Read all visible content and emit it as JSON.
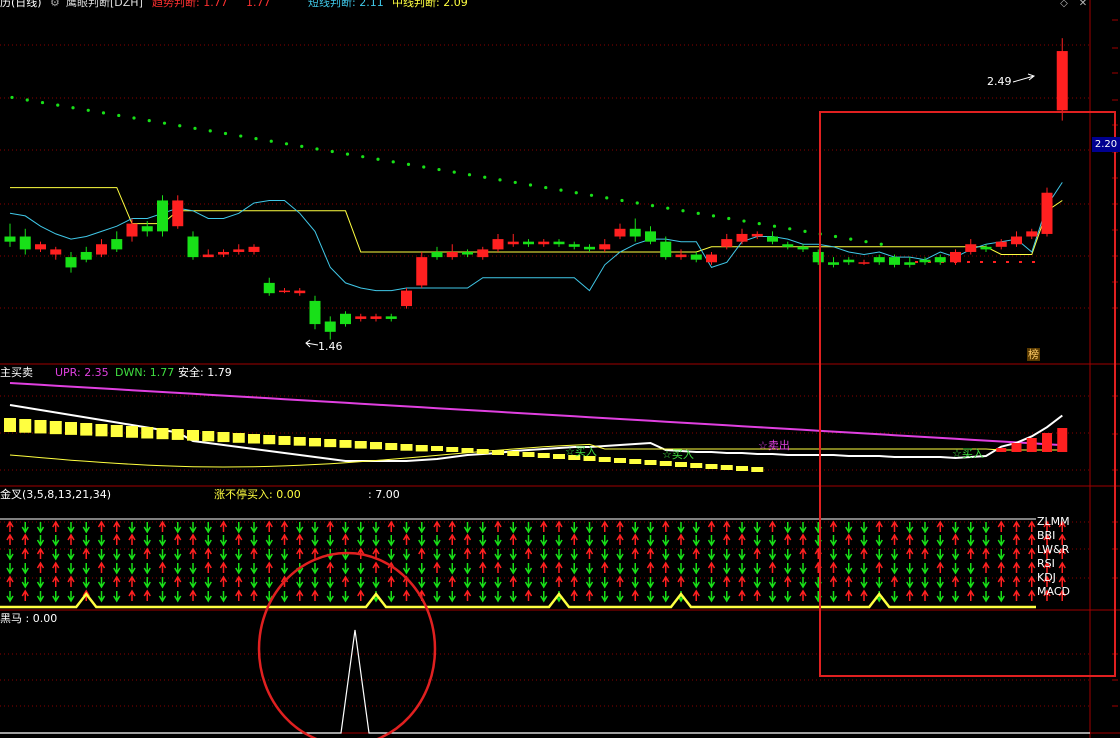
{
  "header": {
    "period_label": "历(日线)",
    "indicator_name": "鹰眼判断[DZH]",
    "trend_label": "趋势判断: 1.77",
    "trend_value2": "1.77",
    "short_label": "短线判断: 2.11",
    "mid_label": "中线判断: 2.09"
  },
  "main_chart": {
    "high_marker": "2.49",
    "low_marker": "1.46",
    "price_axis_value": "2.20",
    "rank_badge": "榜"
  },
  "panel2": {
    "title": "主买卖",
    "upr": "UPR: 2.35",
    "dwn": "DWN: 1.77",
    "safe": "安全: 1.79",
    "signals": [
      "☆买入",
      "☆买入",
      "☆卖出",
      "☆买入"
    ]
  },
  "panel3": {
    "title": "金叉(3,5,8,13,21,34)",
    "limit_label": "涨不停买入: 0.00",
    "extra_value": ": 7.00",
    "row_labels": [
      "ZLMM",
      "BBI",
      "LW&R",
      "RSI",
      "KDJ",
      "MACD"
    ]
  },
  "panel4": {
    "title": "黑马 : 0.00"
  },
  "colors": {
    "up": "#ff2020",
    "down": "#18e018",
    "bg": "#000000",
    "yellow": "#ffff40",
    "cyan": "#40c8e8",
    "magenta": "#e040e0",
    "grid": "#8a0000",
    "highlight_box": "#e02020"
  },
  "chart_data": [
    {
      "type": "candlestick",
      "candles": [
        [
          1.86,
          1.84,
          1.91,
          1.82
        ],
        [
          1.86,
          1.81,
          1.89,
          1.79
        ],
        [
          1.81,
          1.83,
          1.84,
          1.8
        ],
        [
          1.79,
          1.81,
          1.82,
          1.77
        ],
        [
          1.78,
          1.74,
          1.8,
          1.72
        ],
        [
          1.8,
          1.77,
          1.82,
          1.76
        ],
        [
          1.79,
          1.83,
          1.85,
          1.78
        ],
        [
          1.85,
          1.81,
          1.88,
          1.8
        ],
        [
          1.86,
          1.91,
          1.93,
          1.84
        ],
        [
          1.9,
          1.88,
          1.92,
          1.86
        ],
        [
          2.0,
          1.88,
          2.02,
          1.86
        ],
        [
          1.9,
          2.0,
          2.02,
          1.89
        ],
        [
          1.86,
          1.78,
          1.88,
          1.77
        ],
        [
          1.78,
          1.79,
          1.81,
          1.78
        ],
        [
          1.79,
          1.8,
          1.81,
          1.78
        ],
        [
          1.8,
          1.81,
          1.83,
          1.79
        ],
        [
          1.8,
          1.82,
          1.83,
          1.79
        ],
        [
          1.68,
          1.64,
          1.7,
          1.63
        ],
        [
          1.65,
          1.65,
          1.66,
          1.64
        ],
        [
          1.64,
          1.65,
          1.66,
          1.63
        ],
        [
          1.61,
          1.52,
          1.63,
          1.5
        ],
        [
          1.53,
          1.49,
          1.55,
          1.46
        ],
        [
          1.56,
          1.52,
          1.57,
          1.51
        ],
        [
          1.54,
          1.55,
          1.56,
          1.53
        ],
        [
          1.54,
          1.55,
          1.56,
          1.53
        ],
        [
          1.55,
          1.54,
          1.56,
          1.53
        ],
        [
          1.59,
          1.65,
          1.66,
          1.58
        ],
        [
          1.67,
          1.78,
          1.8,
          1.66
        ],
        [
          1.8,
          1.78,
          1.82,
          1.77
        ],
        [
          1.78,
          1.8,
          1.83,
          1.77
        ],
        [
          1.8,
          1.79,
          1.81,
          1.78
        ],
        [
          1.78,
          1.81,
          1.82,
          1.77
        ],
        [
          1.81,
          1.85,
          1.87,
          1.8
        ],
        [
          1.83,
          1.84,
          1.87,
          1.82
        ],
        [
          1.84,
          1.83,
          1.85,
          1.82
        ],
        [
          1.83,
          1.84,
          1.85,
          1.82
        ],
        [
          1.84,
          1.83,
          1.85,
          1.82
        ],
        [
          1.83,
          1.82,
          1.84,
          1.81
        ],
        [
          1.82,
          1.81,
          1.83,
          1.8
        ],
        [
          1.81,
          1.83,
          1.85,
          1.8
        ],
        [
          1.86,
          1.89,
          1.91,
          1.85
        ],
        [
          1.89,
          1.86,
          1.93,
          1.84
        ],
        [
          1.88,
          1.84,
          1.9,
          1.83
        ],
        [
          1.84,
          1.78,
          1.86,
          1.77
        ],
        [
          1.78,
          1.79,
          1.81,
          1.77
        ],
        [
          1.79,
          1.77,
          1.8,
          1.76
        ],
        [
          1.76,
          1.79,
          1.8,
          1.75
        ],
        [
          1.82,
          1.85,
          1.87,
          1.81
        ],
        [
          1.84,
          1.87,
          1.89,
          1.83
        ],
        [
          1.86,
          1.87,
          1.88,
          1.85
        ],
        [
          1.86,
          1.84,
          1.88,
          1.83
        ],
        [
          1.83,
          1.82,
          1.84,
          1.81
        ],
        [
          1.82,
          1.81,
          1.83,
          1.8
        ],
        [
          1.8,
          1.76,
          1.81,
          1.75
        ],
        [
          1.76,
          1.75,
          1.78,
          1.74
        ],
        [
          1.77,
          1.76,
          1.78,
          1.75
        ],
        [
          1.76,
          1.76,
          1.77,
          1.75
        ],
        [
          1.78,
          1.76,
          1.79,
          1.75
        ],
        [
          1.78,
          1.75,
          1.79,
          1.74
        ],
        [
          1.76,
          1.75,
          1.78,
          1.74
        ],
        [
          1.77,
          1.76,
          1.78,
          1.75
        ],
        [
          1.78,
          1.76,
          1.79,
          1.75
        ],
        [
          1.76,
          1.8,
          1.81,
          1.75
        ],
        [
          1.8,
          1.83,
          1.85,
          1.79
        ],
        [
          1.82,
          1.81,
          1.83,
          1.8
        ],
        [
          1.82,
          1.84,
          1.85,
          1.81
        ],
        [
          1.83,
          1.86,
          1.88,
          1.82
        ],
        [
          1.86,
          1.88,
          1.89,
          1.85
        ],
        [
          1.87,
          2.03,
          2.05,
          1.86
        ],
        [
          2.35,
          2.58,
          2.63,
          2.31
        ]
      ],
      "series": [
        {
          "values": [
            2.05,
            2.05,
            2.05,
            2.05,
            2.05,
            2.05,
            2.05,
            2.05,
            1.91,
            1.91,
            1.91,
            1.96,
            1.96,
            1.96,
            1.96,
            1.96,
            1.96,
            1.96,
            1.96,
            1.96,
            1.96,
            1.96,
            1.96,
            1.8,
            1.8,
            1.8,
            1.8,
            1.8,
            1.8,
            1.8,
            1.8,
            1.8,
            1.8,
            1.8,
            1.8,
            1.8,
            1.8,
            1.8,
            1.8,
            1.8,
            1.8,
            1.8,
            1.8,
            1.8,
            1.8,
            1.8,
            1.82,
            1.82,
            1.82,
            1.82,
            1.82,
            1.82,
            1.82,
            1.82,
            1.82,
            1.82,
            1.82,
            1.82,
            1.82,
            1.82,
            1.82,
            1.82,
            1.82,
            1.82,
            1.82,
            1.79,
            1.79,
            1.79,
            1.96,
            2.0
          ]
        },
        {
          "values": [
            1.95,
            1.94,
            1.9,
            1.87,
            1.85,
            1.86,
            1.88,
            1.9,
            1.93,
            1.93,
            1.95,
            1.97,
            1.96,
            1.93,
            1.93,
            1.95,
            1.99,
            2.0,
            2.0,
            1.95,
            1.88,
            1.74,
            1.68,
            1.66,
            1.65,
            1.65,
            1.66,
            1.66,
            1.66,
            1.66,
            1.66,
            1.7,
            1.7,
            1.7,
            1.7,
            1.7,
            1.7,
            1.7,
            1.65,
            1.75,
            1.8,
            1.83,
            1.85,
            1.85,
            1.84,
            1.84,
            1.74,
            1.76,
            1.84,
            1.86,
            1.86,
            1.85,
            1.83,
            1.83,
            1.82,
            1.8,
            1.79,
            1.8,
            1.78,
            1.78,
            1.77,
            1.8,
            1.78,
            1.81,
            1.83,
            1.84,
            1.85,
            1.8,
            1.98,
            2.07
          ]
        },
        {
          "values": [
            2.4,
            2.39,
            2.38,
            2.37,
            2.36,
            2.35,
            2.34,
            2.33,
            2.32,
            2.31,
            2.3,
            2.29,
            2.28,
            2.27,
            2.26,
            2.25,
            2.24,
            2.23,
            2.22,
            2.21,
            2.2,
            2.19,
            2.18,
            2.17,
            2.16,
            2.15,
            2.14,
            2.13,
            2.12,
            2.11,
            2.1,
            2.09,
            2.08,
            2.07,
            2.06,
            2.05,
            2.04,
            2.03,
            2.02,
            2.01,
            2.0,
            1.99,
            1.98,
            1.97,
            1.96,
            1.95,
            1.94,
            1.93,
            1.92,
            1.91,
            1.9,
            1.89,
            1.88,
            1.87,
            1.86,
            1.85,
            1.84,
            1.83,
            1.82,
            1.81,
            1.8,
            1.79,
            1.78,
            1.77,
            1.76,
            1.75,
            1.74,
            1.73,
            1.72,
            1.71
          ]
        }
      ]
    }
  ]
}
